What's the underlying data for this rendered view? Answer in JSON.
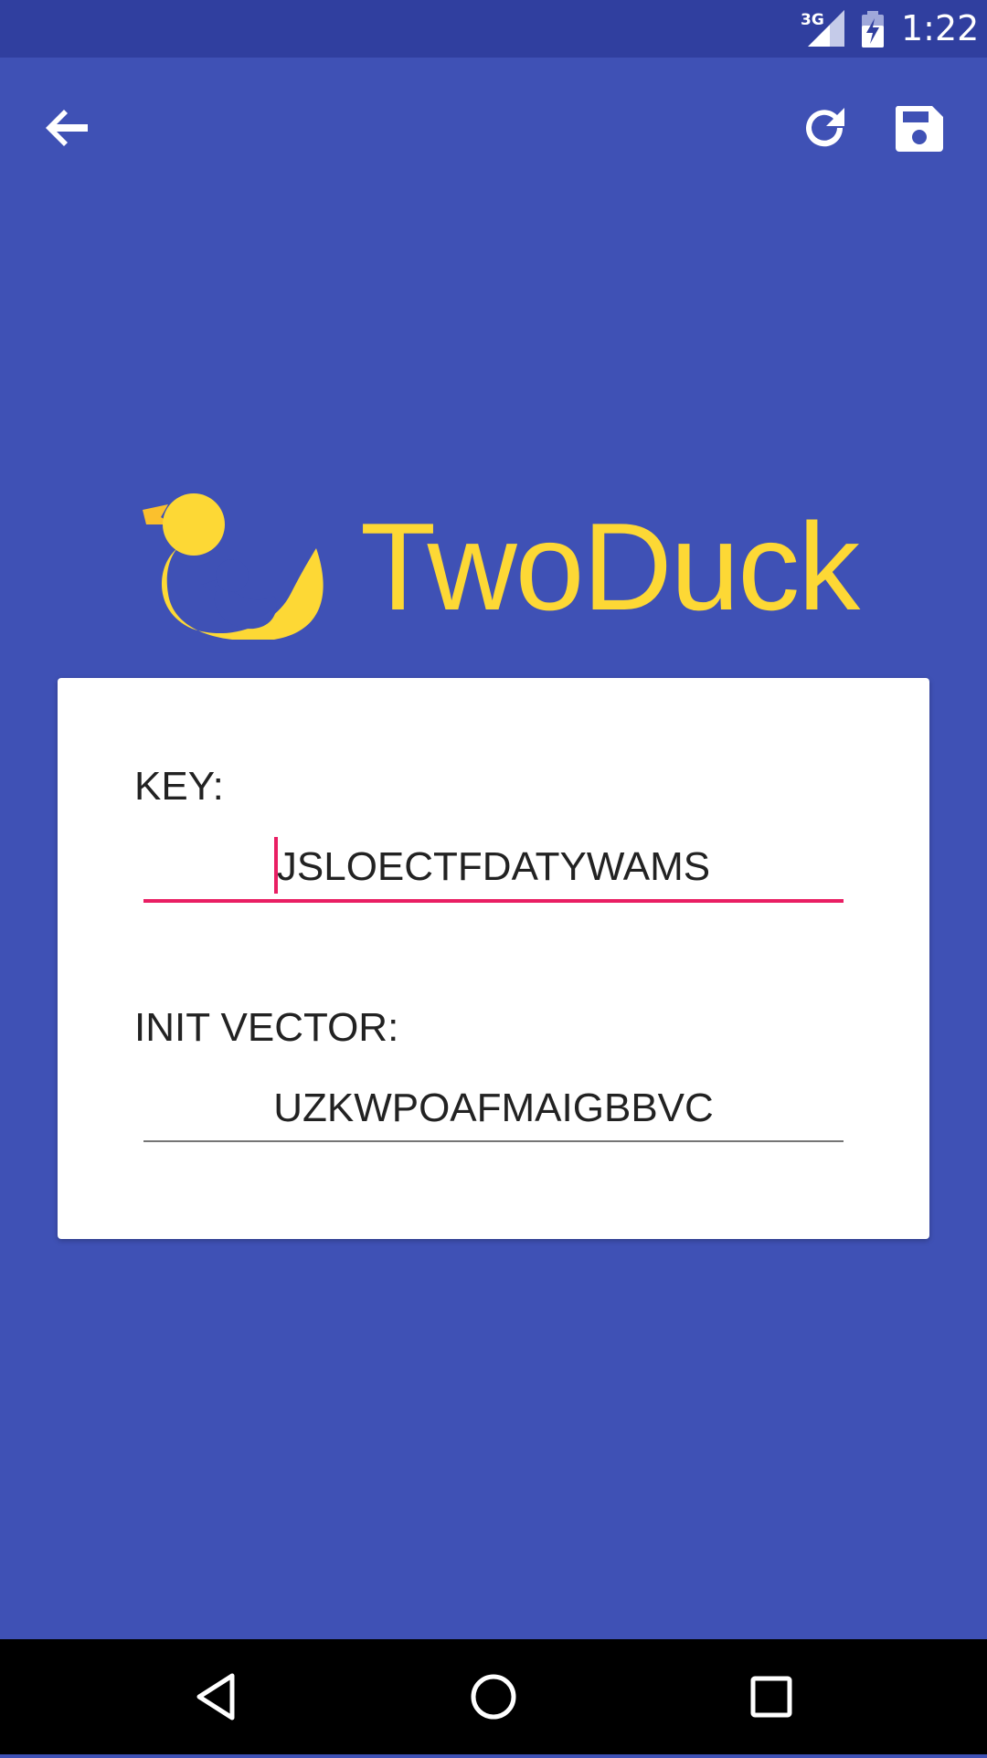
{
  "status_bar": {
    "network": "3G",
    "time": "1:22",
    "icons": [
      "signal-icon",
      "battery-charging-icon"
    ]
  },
  "toolbar": {
    "icons": [
      "back-arrow-icon",
      "refresh-icon",
      "save-icon"
    ]
  },
  "logo": {
    "text": "TwoDuck",
    "color": "#FDD835"
  },
  "form": {
    "key_label": "KEY:",
    "key_value": "JSLOECTFDATYWAMS",
    "iv_label": "INIT VECTOR:",
    "iv_value": "UZKWPOAFMAIGBBVC"
  },
  "colors": {
    "primary": "#3F51B5",
    "primary_dark": "#303F9F",
    "accent": "#E91E63",
    "logo": "#FDD835"
  },
  "nav_bar": {
    "icons": [
      "back-triangle-icon",
      "home-circle-icon",
      "recents-square-icon"
    ]
  }
}
